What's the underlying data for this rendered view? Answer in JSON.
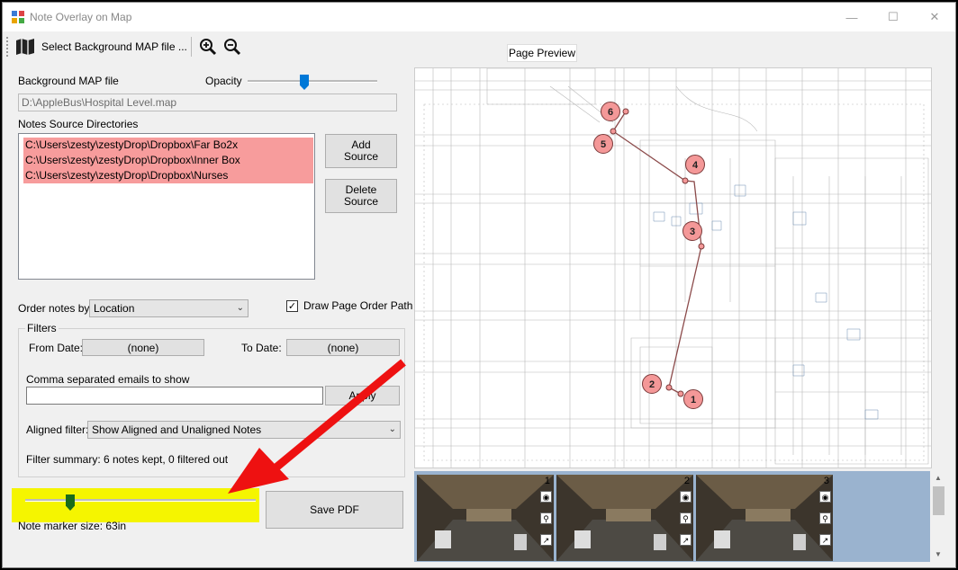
{
  "window": {
    "title": "Note Overlay on Map"
  },
  "toolbar": {
    "select_map_label": "Select Background MAP file ..."
  },
  "preview": {
    "tab_label": "Page Preview"
  },
  "map": {
    "label": "Background MAP file",
    "opacity_label": "Opacity",
    "path_value": "D:\\AppleBus\\Hospital Level.map"
  },
  "sources": {
    "label": "Notes Source Directories",
    "items": [
      "C:\\Users\\zesty\\zestyDrop\\Dropbox\\Far Bo2x",
      "C:\\Users\\zesty\\zestyDrop\\Dropbox\\Inner Box",
      "C:\\Users\\zesty\\zestyDrop\\Dropbox\\Nurses"
    ],
    "add_label": "Add\nSource",
    "delete_label": "Delete\nSource"
  },
  "order": {
    "label": "Order notes by",
    "value": "Location",
    "draw_path_label": "Draw Page Order Path",
    "draw_path_checked": true
  },
  "filters": {
    "group_label": "Filters",
    "from_label": "From Date:",
    "from_value": "(none)",
    "to_label": "To Date:",
    "to_value": "(none)",
    "emails_label": "Comma separated emails to show",
    "emails_value": "",
    "apply_label": "Apply",
    "aligned_label": "Aligned filter:",
    "aligned_value": "Show Aligned and Unaligned Notes",
    "summary": "Filter summary: 6 notes kept, 0 filtered out"
  },
  "marker_size": {
    "label": "Note marker size: 63in"
  },
  "save_label": "Save PDF",
  "markers": [
    "1",
    "2",
    "3",
    "4",
    "5",
    "6"
  ],
  "thumbnails": [
    "1",
    "2",
    "3"
  ],
  "colors": {
    "list_highlight": "#f79c9c",
    "marker": "#f49898",
    "annotation_highlight": "#f5f500",
    "arrow": "#ee1111"
  }
}
